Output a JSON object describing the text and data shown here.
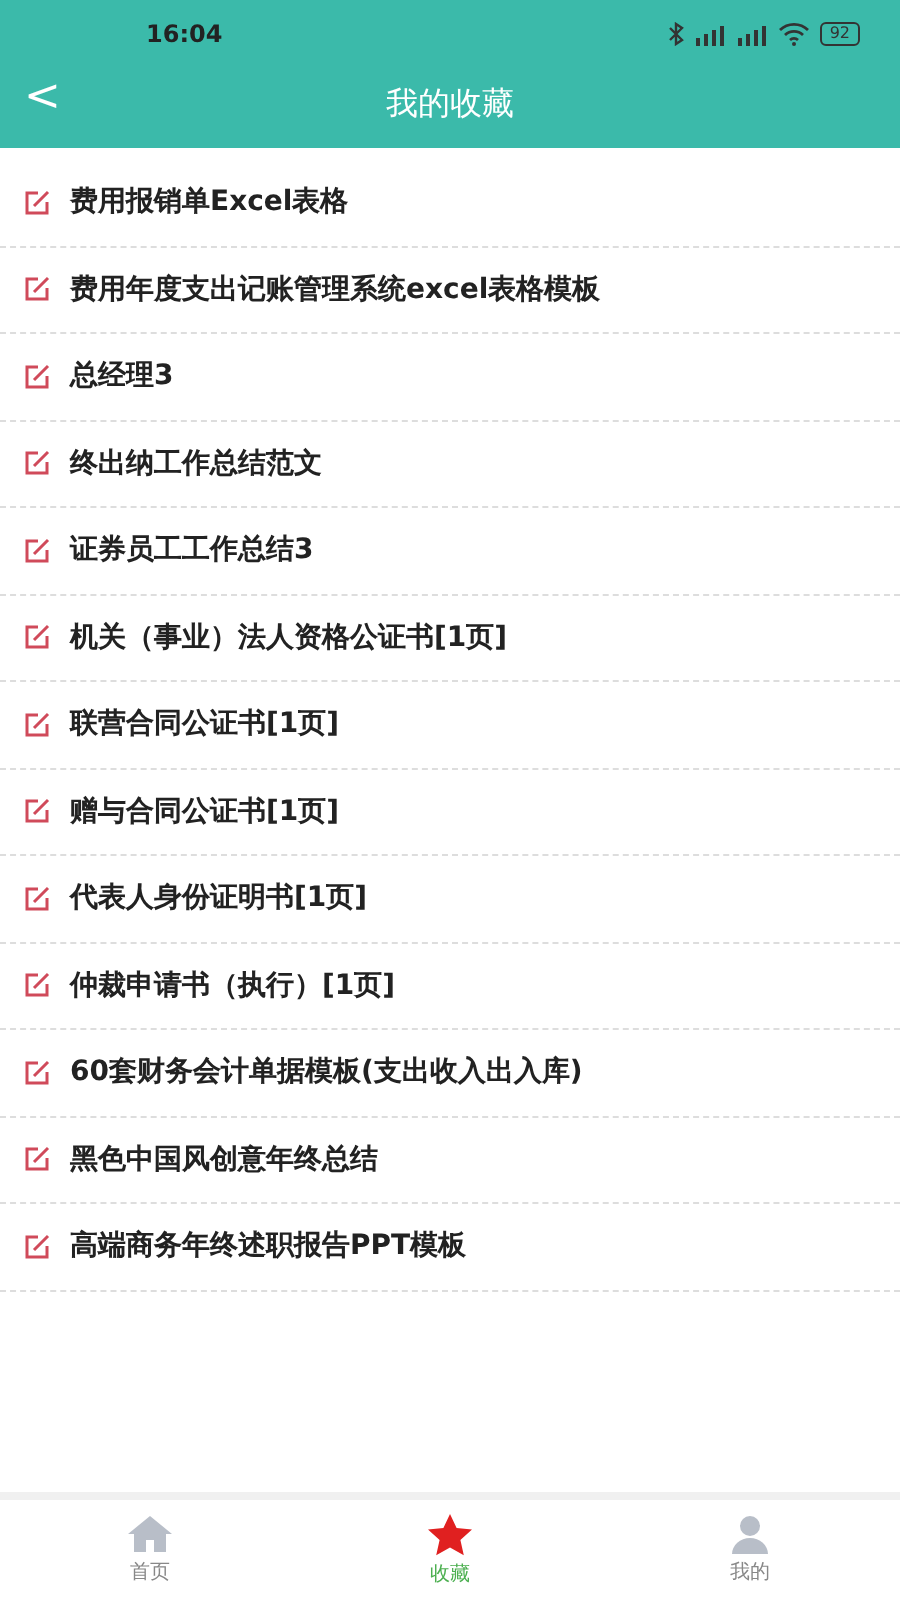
{
  "status_bar": {
    "time": "16:04",
    "battery": "92"
  },
  "header": {
    "back": "<",
    "title": "我的收藏"
  },
  "items": [
    {
      "title": "费用报销单Excel表格"
    },
    {
      "title": "费用年度支出记账管理系统excel表格模板"
    },
    {
      "title": "总经理3"
    },
    {
      "title": "终出纳工作总结范文"
    },
    {
      "title": "证券员工工作总结3"
    },
    {
      "title": "机关（事业）法人资格公证书[1页]"
    },
    {
      "title": "联营合同公证书[1页]"
    },
    {
      "title": "赠与合同公证书[1页]"
    },
    {
      "title": "代表人身份证明书[1页]"
    },
    {
      "title": "仲裁申请书（执行）[1页]"
    },
    {
      "title": "60套财务会计单据模板(支出收入出入库)"
    },
    {
      "title": "黑色中国风创意年终总结"
    },
    {
      "title": "高端商务年终述职报告PPT模板"
    }
  ],
  "tabs": [
    {
      "kind": "home",
      "label": "首页",
      "selected": false
    },
    {
      "kind": "star",
      "label": "收藏",
      "selected": true
    },
    {
      "kind": "person",
      "label": "我的",
      "selected": false
    }
  ]
}
